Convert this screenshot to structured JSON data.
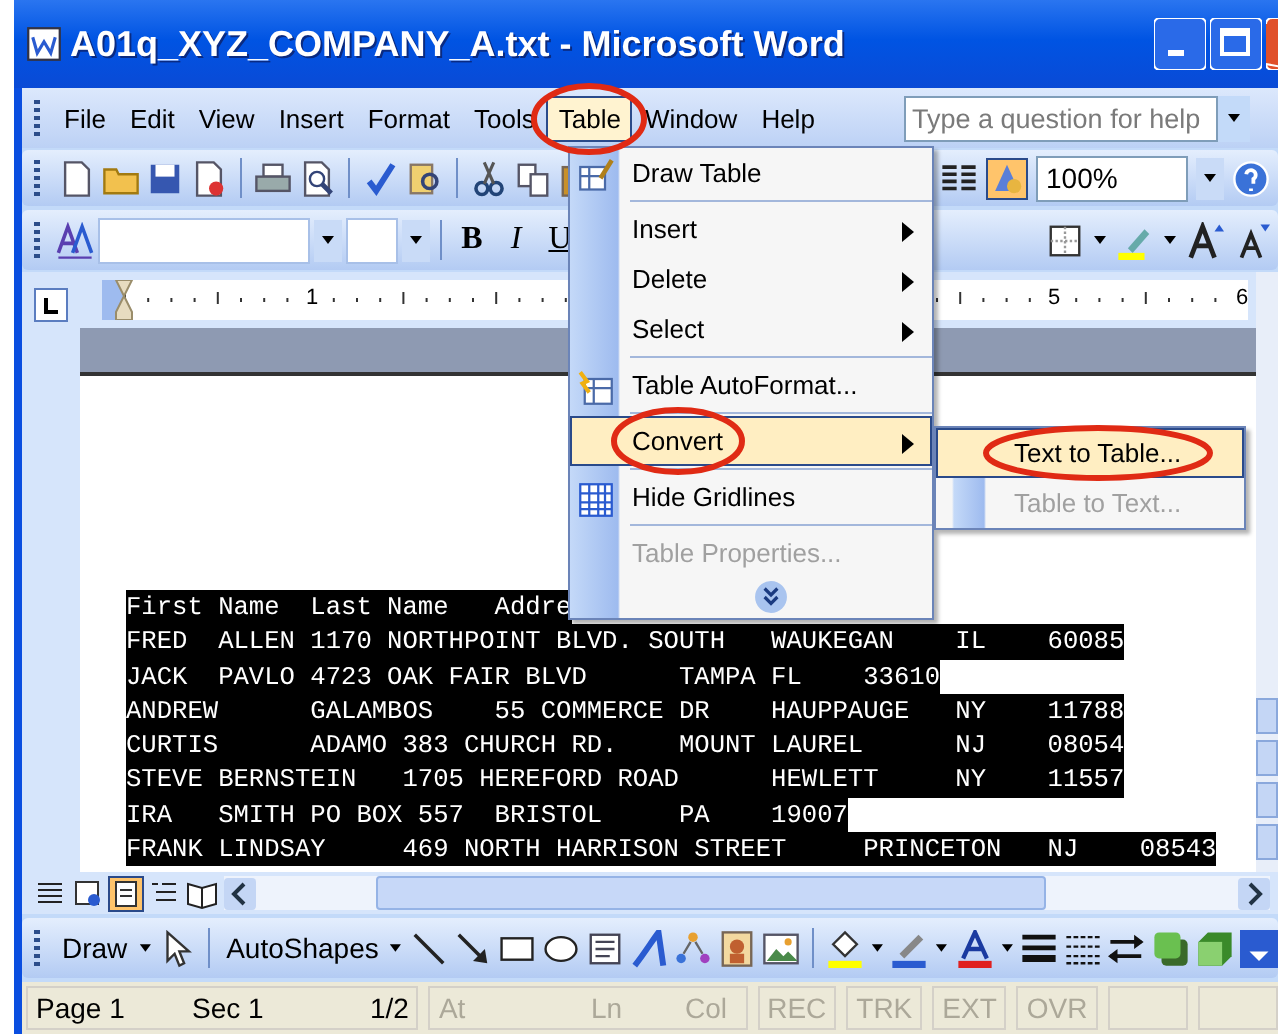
{
  "window": {
    "title": "A01q_XYZ_COMPANY_A.txt - Microsoft Word"
  },
  "menu_bar": [
    {
      "label": "File",
      "selected": false,
      "circled": false
    },
    {
      "label": "Edit",
      "selected": false,
      "circled": false
    },
    {
      "label": "View",
      "selected": false,
      "circled": false
    },
    {
      "label": "Insert",
      "selected": false,
      "circled": false
    },
    {
      "label": "Format",
      "selected": false,
      "circled": false
    },
    {
      "label": "Tools",
      "selected": false,
      "circled": false
    },
    {
      "label": "Table",
      "selected": true,
      "circled": true
    },
    {
      "label": "Window",
      "selected": false,
      "circled": false
    },
    {
      "label": "Help",
      "selected": false,
      "circled": false
    }
  ],
  "help_box": {
    "placeholder": "Type a question for help"
  },
  "standard_toolbar": {
    "zoom": "100%"
  },
  "formatting_toolbar": {
    "buttons": [
      "B",
      "I",
      "U"
    ]
  },
  "ruler": {
    "labels": [
      "1",
      "5",
      "6"
    ]
  },
  "document": {
    "lines": [
      {
        "text": "First Name  Last Name   Addre",
        "selected": true
      },
      {
        "text": "FRED  ALLEN 1170 NORTHPOINT BLVD. SOUTH   WAUKEGAN    IL    60085",
        "selected": true
      },
      {
        "text": "JACK  PAVLO 4723 OAK FAIR BLVD      TAMPA FL    33610",
        "selected": true
      },
      {
        "text": "ANDREW      GALAMBOS    55 COMMERCE DR    HAUPPAUGE   NY    11788",
        "selected": true
      },
      {
        "text": "CURTIS      ADAMO 383 CHURCH RD.    MOUNT LAUREL      NJ    08054",
        "selected": true
      },
      {
        "text": "STEVE BERNSTEIN   1705 HEREFORD ROAD      HEWLETT     NY    11557",
        "selected": true
      },
      {
        "text": "IRA   SMITH PO BOX 557  BRISTOL     PA    19007",
        "selected": true
      },
      {
        "text": "FRANK LINDSAY     469 NORTH HARRISON STREET     PRINCETON   NJ    08543",
        "selected": true
      }
    ]
  },
  "table_menu": {
    "items": [
      {
        "label": "Draw Table",
        "kind": "command",
        "separator_before": false,
        "selected": false,
        "disabled": false,
        "circled": false
      },
      {
        "label": "Insert",
        "kind": "submenu",
        "separator_before": true,
        "selected": false,
        "disabled": false,
        "circled": false
      },
      {
        "label": "Delete",
        "kind": "submenu",
        "separator_before": false,
        "selected": false,
        "disabled": false,
        "circled": false
      },
      {
        "label": "Select",
        "kind": "submenu",
        "separator_before": false,
        "selected": false,
        "disabled": false,
        "circled": false
      },
      {
        "label": "Table AutoFormat...",
        "kind": "command",
        "separator_before": true,
        "selected": false,
        "disabled": false,
        "circled": false
      },
      {
        "label": "Convert",
        "kind": "submenu",
        "separator_before": true,
        "selected": true,
        "disabled": false,
        "circled": true
      },
      {
        "label": "Hide Gridlines",
        "kind": "command",
        "separator_before": true,
        "selected": false,
        "disabled": false,
        "circled": false
      },
      {
        "label": "Table Properties...",
        "kind": "command",
        "separator_before": true,
        "selected": false,
        "disabled": true,
        "circled": false
      },
      {
        "kind": "more"
      }
    ]
  },
  "convert_submenu": {
    "items": [
      {
        "label": "Text to Table...",
        "selected": true,
        "disabled": false,
        "circled": true
      },
      {
        "label": "Table to Text...",
        "selected": false,
        "disabled": true,
        "circled": false
      }
    ]
  },
  "drawing_toolbar": {
    "draw": "Draw",
    "autoshapes": "AutoShapes"
  },
  "status_bar": [
    {
      "fields": [
        {
          "text": "Page 1",
          "dimmed": false
        },
        {
          "text": "Sec 1",
          "dimmed": false
        },
        {
          "text": "1/2",
          "dimmed": false
        }
      ]
    },
    {
      "fields": [
        {
          "text": "At",
          "dimmed": true
        },
        {
          "text": "Ln",
          "dimmed": true
        },
        {
          "text": "Col",
          "dimmed": true
        }
      ]
    },
    {
      "fields": [
        {
          "text": "REC",
          "dimmed": true
        }
      ]
    },
    {
      "fields": [
        {
          "text": "TRK",
          "dimmed": true
        }
      ]
    },
    {
      "fields": [
        {
          "text": "EXT",
          "dimmed": true
        }
      ]
    },
    {
      "fields": [
        {
          "text": "OVR",
          "dimmed": true
        }
      ]
    }
  ]
}
